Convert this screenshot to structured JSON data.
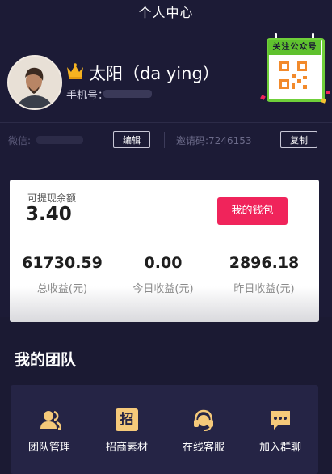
{
  "header": {
    "title": "个人中心"
  },
  "profile": {
    "name": "太阳（da ying）",
    "phone_label": "手机号："
  },
  "qr_badge": {
    "label": "关注公众号"
  },
  "account_row": {
    "wechat_label": "微信:",
    "edit_label": "编辑",
    "invite_text": "邀请码:7246153",
    "copy_label": "复制"
  },
  "balance": {
    "label": "可提现余额",
    "value": "3.40",
    "wallet_button": "我的钱包"
  },
  "stats": [
    {
      "value": "61730.59",
      "label": "总收益(元)"
    },
    {
      "value": "0.00",
      "label": "今日收益(元)"
    },
    {
      "value": "2896.18",
      "label": "昨日收益(元)"
    }
  ],
  "team": {
    "title": "我的团队",
    "icon_char": "招",
    "items": [
      {
        "label": "团队管理",
        "icon": "team-management-icon"
      },
      {
        "label": "招商素材",
        "icon": "recruit-materials-icon"
      },
      {
        "label": "在线客服",
        "icon": "headset-icon"
      },
      {
        "label": "加入群聊",
        "icon": "chat-bubble-icon"
      }
    ]
  },
  "colors": {
    "background": "#1b1a33",
    "accent_pink": "#f0245b",
    "icon_gold": "#f5c97a",
    "badge_green": "#5fc12e"
  }
}
